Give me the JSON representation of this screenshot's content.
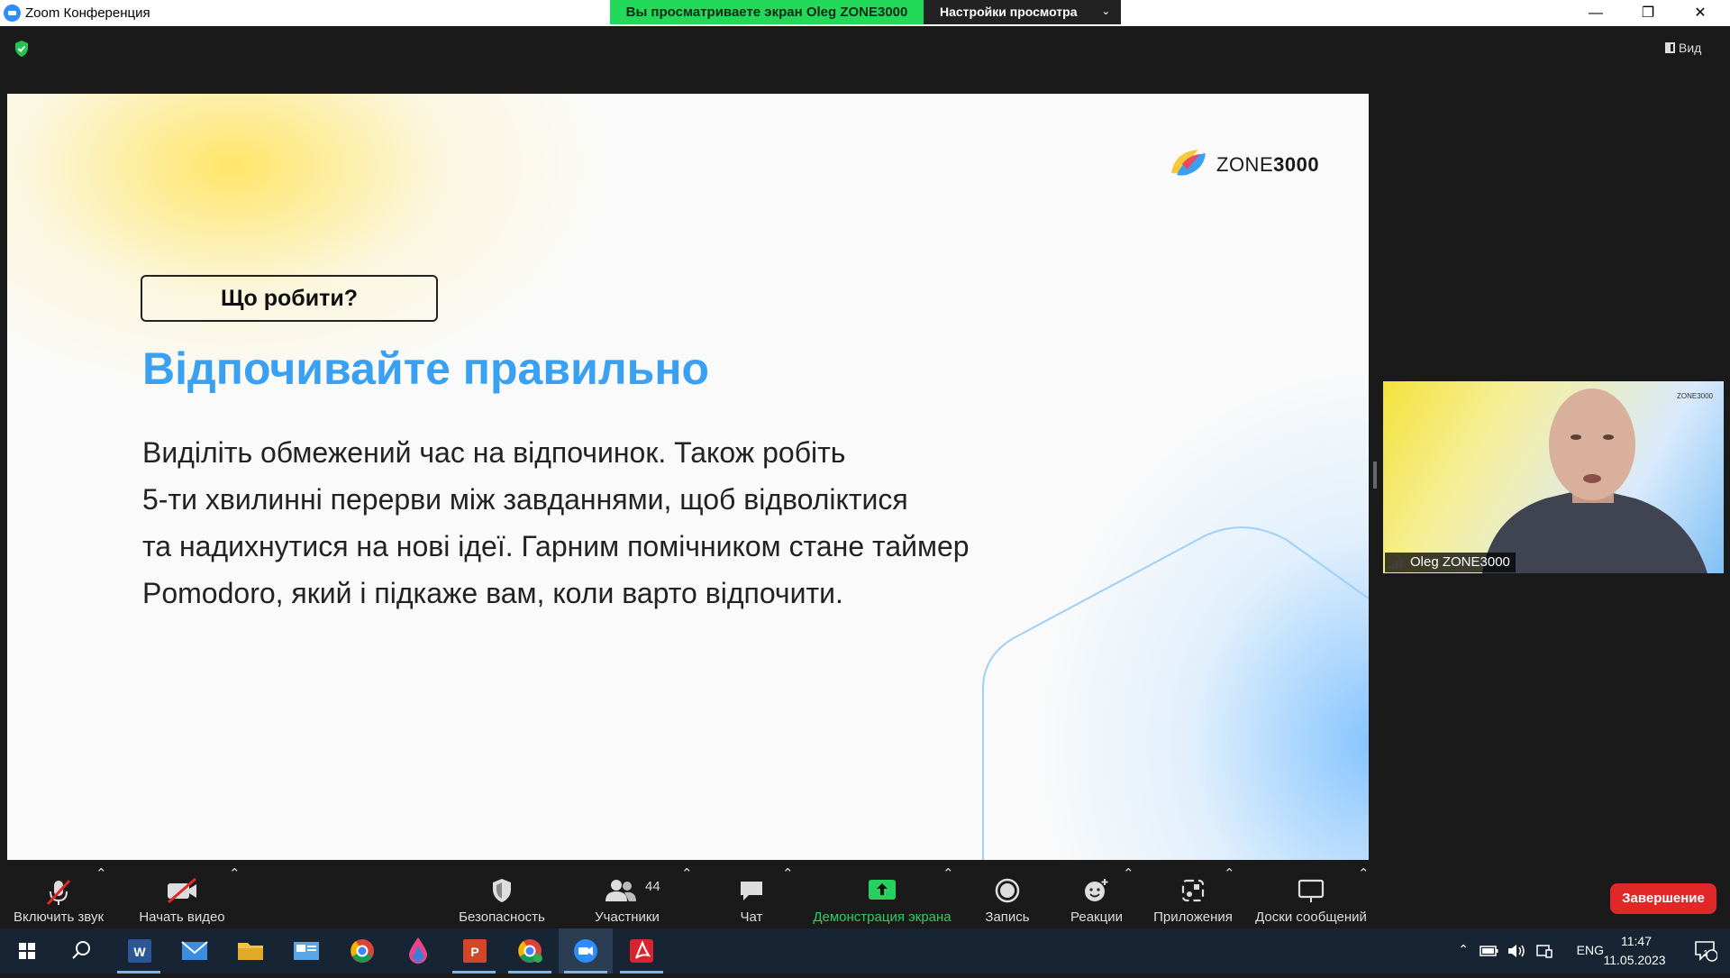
{
  "window": {
    "title": "Zoom Конференция",
    "minimize": "—",
    "restore": "❐",
    "close": "✕"
  },
  "share_banner": {
    "text": "Вы просматриваете экран Oleg ZONE3000",
    "settings_label": "Настройки просмотра"
  },
  "view_button": {
    "label": "Вид"
  },
  "slide": {
    "logo_text_light": "ZONE",
    "logo_text_bold": "3000",
    "question": "Що робити?",
    "heading": "Відпочивайте правильно",
    "body_lines": [
      "Виділіть обмежений час на відпочинок. Також робіть",
      "5-ти хвилинні перерви між завданнями, щоб відволіктися",
      "та надихнутися на нові ідеї. Гарним помічником стане таймер",
      "Pomodoro, який і підкаже вам, коли варто відпочити."
    ]
  },
  "participant": {
    "name": "Oleg ZONE3000",
    "background_logo": "ZONE3000"
  },
  "toolbar": {
    "unmute": "Включить звук",
    "start_video": "Начать видео",
    "security": "Безопасность",
    "participants": "Участники",
    "participants_count": "44",
    "chat": "Чат",
    "share_screen": "Демонстрация экрана",
    "record": "Запись",
    "reactions": "Реакции",
    "apps": "Приложения",
    "whiteboards": "Доски сообщений",
    "end": "Завершение"
  },
  "taskbar": {
    "language": "ENG",
    "time": "11:47",
    "date": "11.05.2023",
    "notifications": "1",
    "apps": [
      "start-icon",
      "search-icon",
      "word-icon",
      "mail-icon",
      "explorer-icon",
      "control-panel-icon",
      "chrome-icon",
      "paint-icon",
      "powerpoint-icon",
      "chrome-profile-icon",
      "zoom-icon",
      "acrobat-icon"
    ]
  },
  "colors": {
    "accent_blue": "#3aa0f2",
    "share_green": "#23d959",
    "end_red": "#e02828"
  }
}
